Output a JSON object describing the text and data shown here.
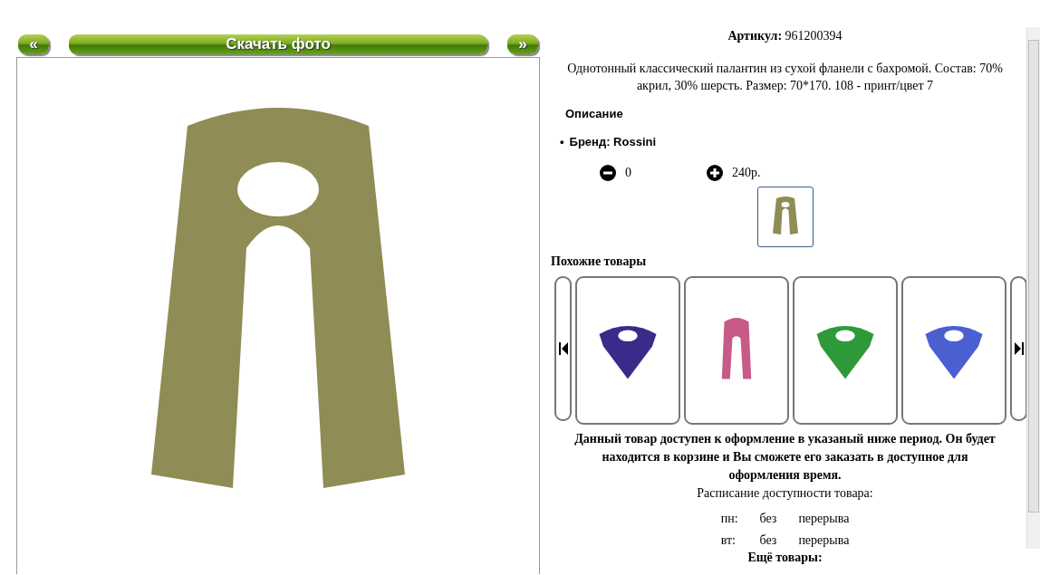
{
  "photo_nav": {
    "prev": "«",
    "download": "Скачать фото",
    "next": "»"
  },
  "main_photo": {
    "color": "#8f8c55"
  },
  "product": {
    "article_label": "Артикул:",
    "article": "961200394",
    "description": "Однотонный классический палантин из сухой фланели с бахромой. Состав: 70% акрил, 30% шерсть. Размер: 70*170. 108 - принт/цвет 7",
    "details_title": "Описание",
    "details": [
      {
        "marker": "•",
        "text": "Бренд: Rossini"
      }
    ],
    "quantity": "0",
    "price": "240р.",
    "thumbnails": [
      {
        "color": "#8f8c55",
        "selected": true
      }
    ]
  },
  "similar": {
    "title": "Похожие товары",
    "items": [
      {
        "color": "#3a2a8a",
        "kind": "square"
      },
      {
        "color": "#c75a86",
        "kind": "long"
      },
      {
        "color": "#2f9a3a",
        "kind": "square"
      },
      {
        "color": "#4a5fd0",
        "kind": "square"
      }
    ]
  },
  "availability": {
    "notice": "Данный товар доступен к оформление в указаный ниже период. Он будет находится в корзине и Вы сможете его заказать в доступное для оформления время.",
    "schedule_title": "Расписание доступности товара:",
    "schedule": [
      {
        "day": "пн:",
        "from": "без",
        "to": "перерыва"
      },
      {
        "day": "вт:",
        "from": "без",
        "to": "перерыва"
      }
    ]
  },
  "more": {
    "title": "Ещё товары:"
  }
}
